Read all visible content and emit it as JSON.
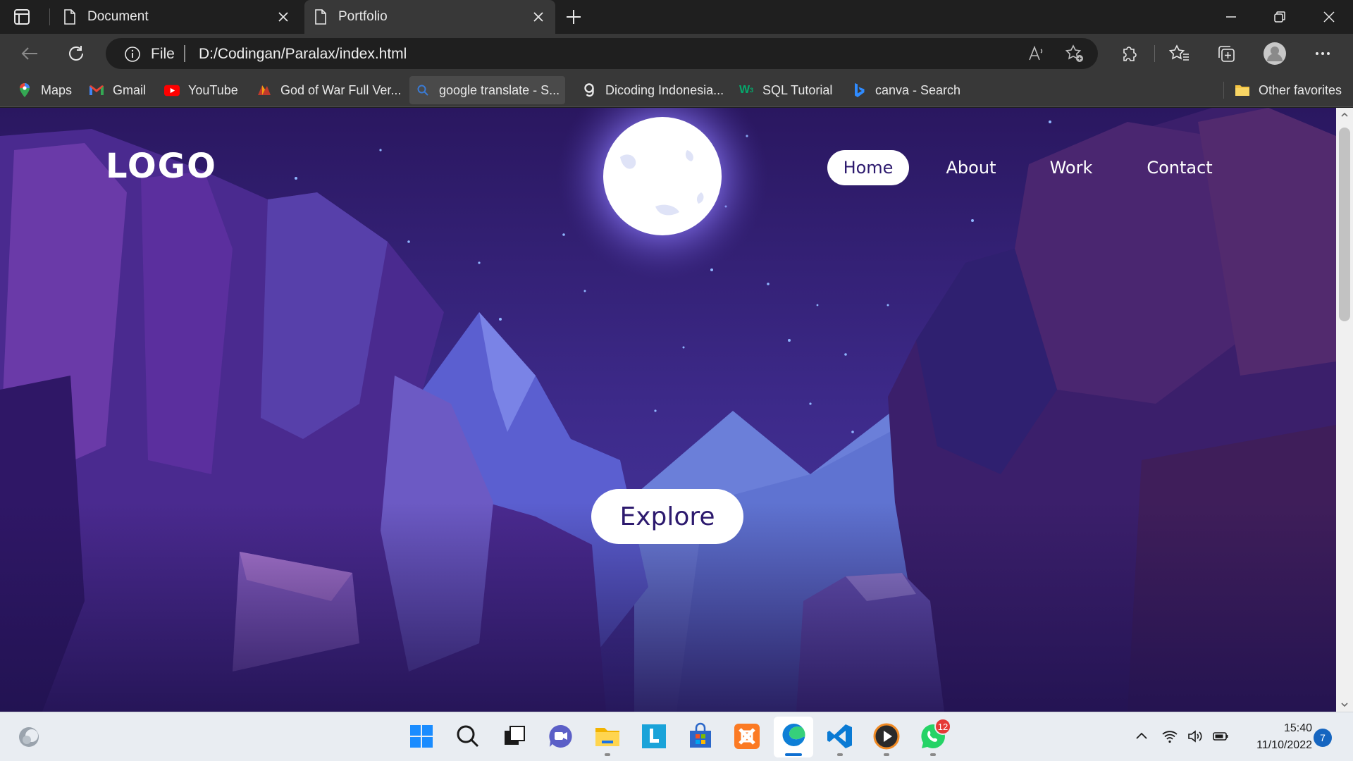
{
  "browser": {
    "tabs": [
      {
        "title": "Document",
        "active": false
      },
      {
        "title": "Portfolio",
        "active": true
      }
    ],
    "address": {
      "scheme_label": "File",
      "url": "D:/Codingan/Paralax/index.html"
    },
    "favorites": [
      {
        "label": "Maps",
        "icon": "maps-icon"
      },
      {
        "label": "Gmail",
        "icon": "gmail-icon"
      },
      {
        "label": "YouTube",
        "icon": "youtube-icon"
      },
      {
        "label": "God of War Full Ver...",
        "icon": "game-icon"
      },
      {
        "label": "google translate - S...",
        "icon": "search-icon"
      },
      {
        "label": "Dicoding Indonesia...",
        "icon": "dicoding-icon"
      },
      {
        "label": "SQL Tutorial",
        "icon": "w3schools-icon"
      },
      {
        "label": "canva - Search",
        "icon": "bing-icon"
      }
    ],
    "other_favorites": "Other favorites"
  },
  "page": {
    "logo": "LOGO",
    "nav": [
      {
        "label": "Home",
        "active": true
      },
      {
        "label": "About",
        "active": false
      },
      {
        "label": "Work",
        "active": false
      },
      {
        "label": "Contact",
        "active": false
      }
    ],
    "cta": "Explore",
    "colors": {
      "sky_top": "#2a1760",
      "sky_mid": "#3d2a8a",
      "accent": "#2d1a6e",
      "moon": "#ffffff"
    }
  },
  "taskbar": {
    "apps": [
      "windows-start-icon",
      "search-icon",
      "task-view-icon",
      "teams-chat-icon",
      "file-explorer-icon",
      "lesson-app-icon",
      "store-icon",
      "xampp-icon",
      "edge-icon",
      "vscode-icon",
      "media-player-icon",
      "whatsapp-icon"
    ],
    "whatsapp_badge": "12",
    "time": "15:40",
    "date": "11/10/2022",
    "notifications": "7"
  }
}
